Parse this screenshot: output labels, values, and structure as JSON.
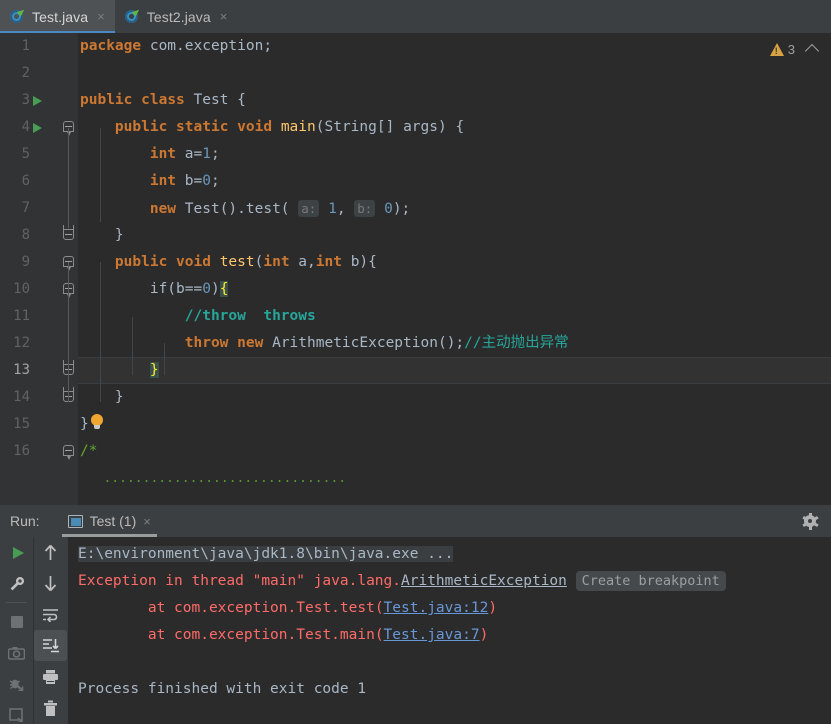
{
  "editor_tabs": [
    {
      "label": "Test.java",
      "icon": "java-class-icon",
      "active": true,
      "close": "×"
    },
    {
      "label": "Test2.java",
      "icon": "java-class-icon",
      "active": false,
      "close": "×"
    }
  ],
  "inspection": {
    "warning_icon": "warning-triangle-icon",
    "count": "3",
    "collapse_icon": "chevron-up-icon"
  },
  "code": {
    "line_numbers": [
      "1",
      "2",
      "3",
      "4",
      "5",
      "6",
      "7",
      "8",
      "9",
      "10",
      "11",
      "12",
      "13",
      "14",
      "15",
      "16"
    ],
    "lines": [
      {
        "n": "1",
        "text": "package com.exception;"
      },
      {
        "n": "2",
        "text": ""
      },
      {
        "n": "3",
        "text": "public class Test {"
      },
      {
        "n": "4",
        "text": "    public static void main(String[] args) {"
      },
      {
        "n": "5",
        "text": "        int a=1;"
      },
      {
        "n": "6",
        "text": "        int b=0;"
      },
      {
        "n": "7",
        "text": "        new Test().test( a: 1, b: 0);"
      },
      {
        "n": "8",
        "text": "    }"
      },
      {
        "n": "9",
        "text": "    public void test(int a,int b){"
      },
      {
        "n": "10",
        "text": "        if(b==0){"
      },
      {
        "n": "11",
        "text": "            //throw  throws"
      },
      {
        "n": "12",
        "text": "            throw new ArithmeticException();//主动抛出异常"
      },
      {
        "n": "13",
        "text": "        }"
      },
      {
        "n": "14",
        "text": "    }"
      },
      {
        "n": "15",
        "text": "}"
      },
      {
        "n": "16",
        "text": "/*"
      }
    ],
    "tokens": {
      "kw_package": "package",
      "pkg_name": "com.exception;",
      "kw_public": "public",
      "kw_class": "class",
      "type_test": "Test",
      "brace_open": "{",
      "kw_static": "static",
      "kw_void": "void",
      "m_main": "main",
      "t_string": "String",
      "p_args": "args",
      "kw_int": "int",
      "v_a": "a",
      "v_b": "b",
      "n_1": "1",
      "n_0": "0",
      "kw_new": "new",
      "m_test": "test",
      "hint_a": "a:",
      "hint_b": "b:",
      "kw_if": "if",
      "cmt_throw": "//throw  throws",
      "kw_throw": "throw",
      "t_arith": "ArithmeticException",
      "cmt_cn": "//主动抛出异常",
      "block_comment_open": "/*"
    },
    "current_line": "13",
    "quickfix_icon": "lightbulb-icon",
    "run_gutter_icon": "run-arrow-icon"
  },
  "run_panel": {
    "label": "Run:",
    "tab": {
      "label": "Test (1)",
      "icon": "console-window-icon",
      "close": "×"
    },
    "settings_icon": "gear-icon",
    "toolbar_left": [
      {
        "name": "rerun-icon"
      },
      {
        "name": "wrench-settings-icon"
      },
      {
        "name": "stop-icon"
      },
      {
        "name": "camera-snapshot-icon"
      },
      {
        "name": "bug-disabled-icon"
      },
      {
        "name": "export-icon"
      }
    ],
    "toolbar_right": [
      {
        "name": "arrow-up-icon"
      },
      {
        "name": "arrow-down-icon"
      },
      {
        "name": "soft-wrap-icon"
      },
      {
        "name": "scroll-to-end-icon",
        "selected": true
      },
      {
        "name": "print-icon"
      },
      {
        "name": "trash-icon"
      }
    ],
    "console": {
      "command": "E:\\environment\\java\\jdk1.8\\bin\\java.exe ...",
      "exception_prefix": "Exception in thread \"main\" java.lang.",
      "exception_class": "ArithmeticException",
      "breakpoint_hint": "Create breakpoint",
      "stack": [
        {
          "prefix": "\tat com.exception.Test.test(",
          "link": "Test.java:12",
          "suffix": ")"
        },
        {
          "prefix": "\tat com.exception.Test.main(",
          "link": "Test.java:7",
          "suffix": ")"
        }
      ],
      "exit_line": "Process finished with exit code 1"
    }
  },
  "colors": {
    "editor_bg": "#2B2B2B",
    "gutter_bg": "#313335",
    "chrome_bg": "#3C3F41",
    "keyword": "#CC7832",
    "number": "#6897BB",
    "comment_teal": "#26A69A",
    "comment_green": "#5FA832",
    "error_red": "#FF6B68",
    "link_blue": "#6897D8",
    "accent_blue": "#4A88C7",
    "warning_yellow": "#D9A343",
    "run_green": "#499C54",
    "default_text": "#A9B7C6"
  }
}
